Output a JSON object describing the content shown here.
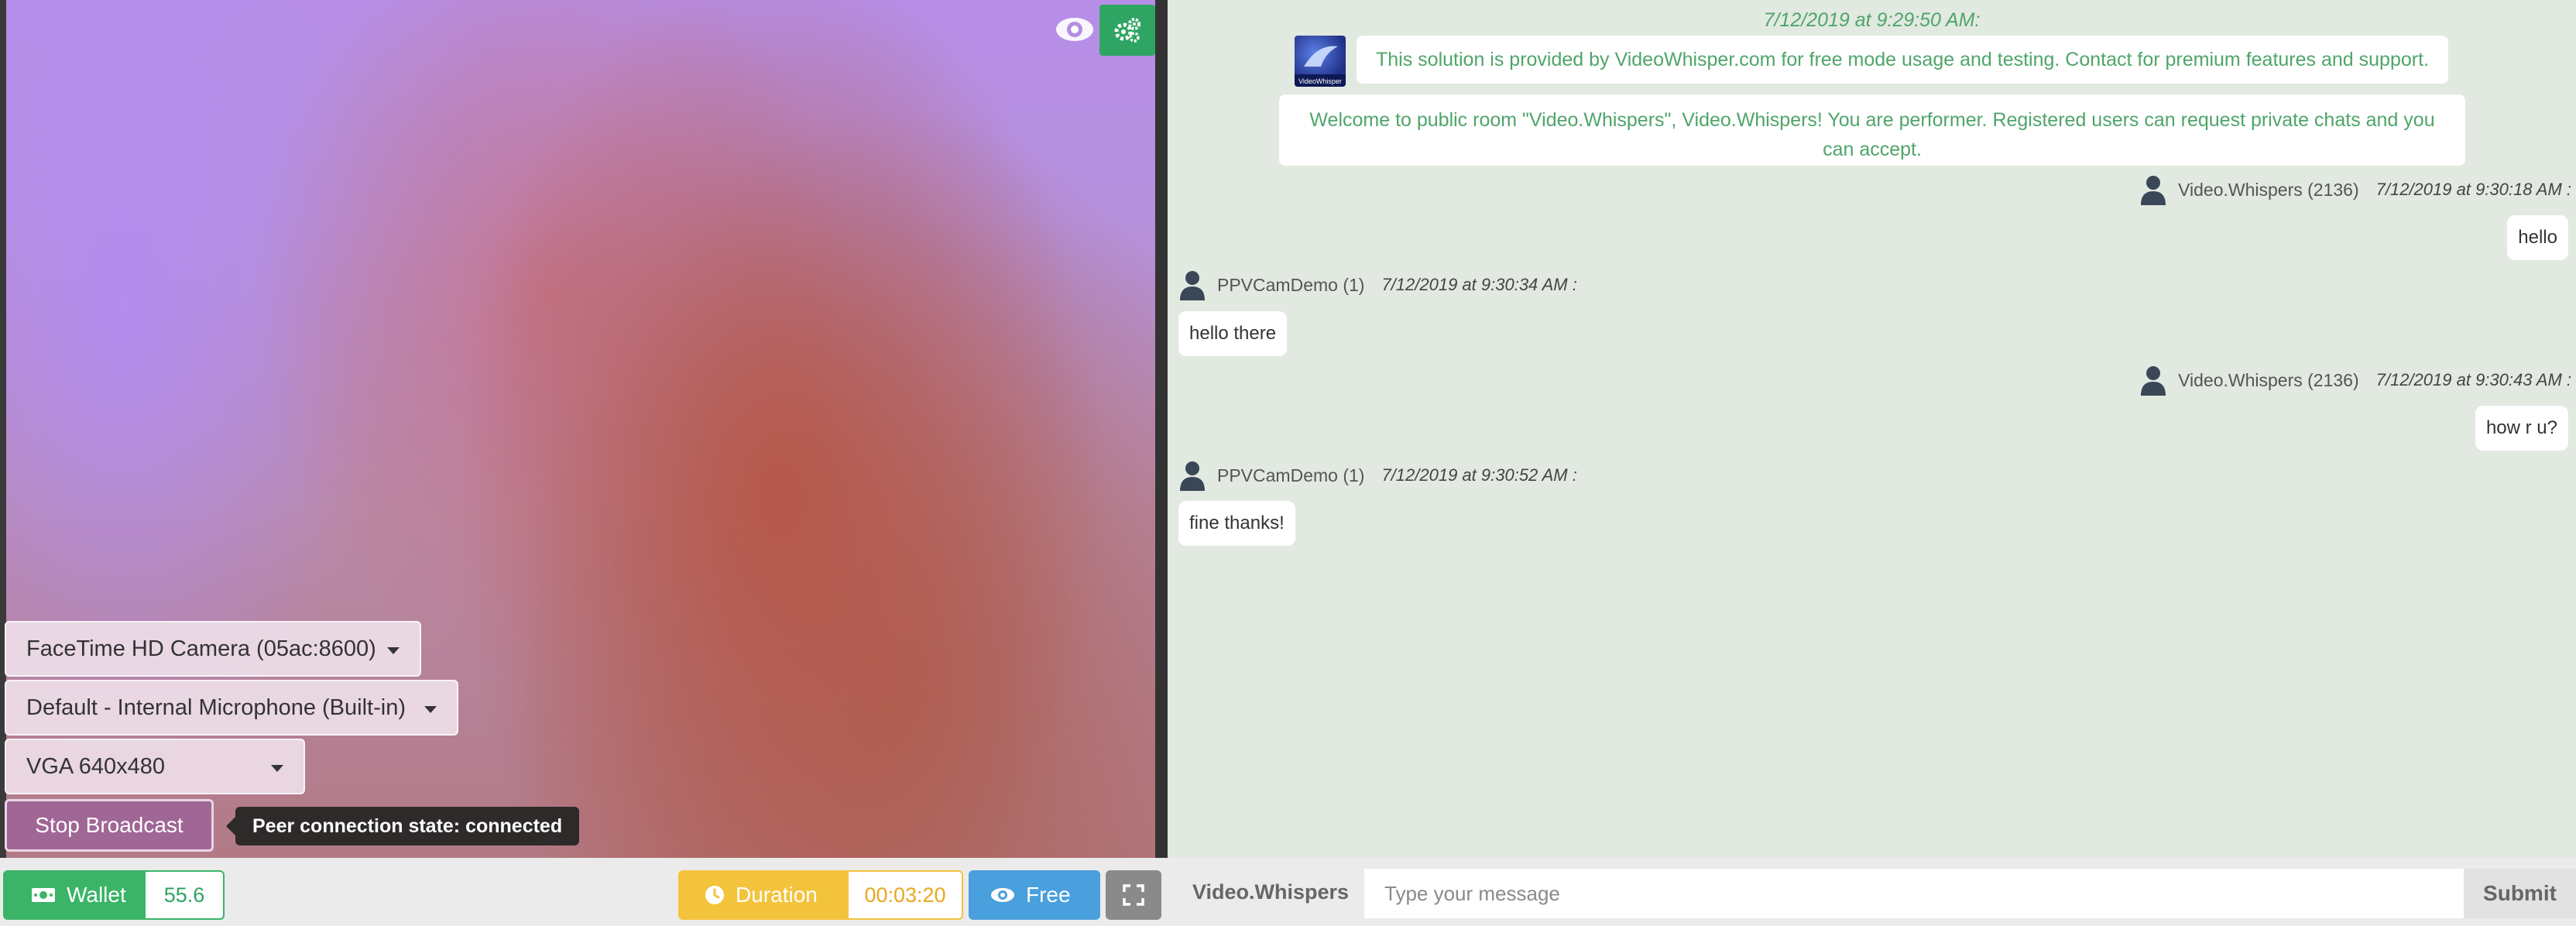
{
  "video": {
    "camera_select": "FaceTime HD Camera (05ac:8600)",
    "mic_select": "Default - Internal Microphone (Built-in)",
    "resolution_select": "VGA 640x480",
    "stop_button": "Stop Broadcast",
    "peer_status": "Peer connection state: connected"
  },
  "bottom_bar": {
    "wallet_label": "Wallet",
    "wallet_value": "55.6",
    "duration_label": "Duration",
    "duration_value": "00:03:20",
    "free_label": "Free"
  },
  "chat": {
    "system_time": "7/12/2019 at 9:29:50 AM:",
    "system_notice": "This solution is provided by VideoWhisper.com for free mode usage and testing. Contact for premium features and support.",
    "welcome": "Welcome to public room \"Video.Whispers\", Video.Whispers! You are performer. Registered users can request private chats and you can accept.",
    "messages": [
      {
        "name": "Video.Whispers (2136)",
        "time": "7/12/2019 at 9:30:18 AM :",
        "text": "hello",
        "side": "right"
      },
      {
        "name": "PPVCamDemo (1)",
        "time": "7/12/2019 at 9:30:34 AM :",
        "text": "hello there",
        "side": "left"
      },
      {
        "name": "Video.Whispers (2136)",
        "time": "7/12/2019 at 9:30:43 AM :",
        "text": "how r u?",
        "side": "right"
      },
      {
        "name": "PPVCamDemo (1)",
        "time": "7/12/2019 at 9:30:52 AM :",
        "text": "fine thanks!",
        "side": "left"
      }
    ],
    "username": "Video.Whispers",
    "input_placeholder": "Type your message",
    "submit_label": "Submit"
  },
  "colors": {
    "accent_green": "#3bb467",
    "accent_yellow": "#f4c33c",
    "accent_blue": "#4a9fdd",
    "chat_background": "#e1e9e0",
    "system_text": "#4fa56a"
  },
  "icons": [
    "eye-icon",
    "gears-icon",
    "money-icon",
    "clock-icon",
    "fullscreen-icon",
    "user-icon"
  ]
}
